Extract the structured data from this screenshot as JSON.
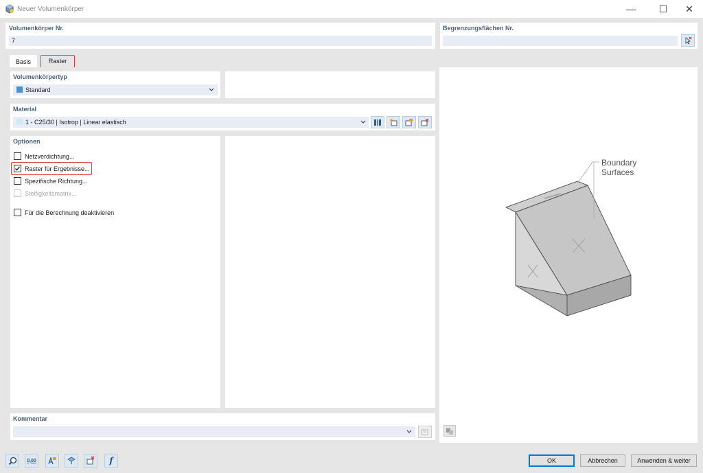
{
  "window": {
    "title": "Neuer Volumenkörper",
    "minimize_glyph": "—",
    "maximize_glyph": "☐",
    "close_glyph": "✕"
  },
  "header": {
    "solid_no_label": "Volumenkörper Nr.",
    "solid_no_value": "7",
    "boundary_label": "Begrenzungsflächen Nr.",
    "boundary_value": ""
  },
  "tabs": [
    {
      "label": "Basis",
      "active": true
    },
    {
      "label": "Raster",
      "active": false,
      "highlighted": true
    }
  ],
  "solid_type": {
    "label": "Volumenkörpertyp",
    "value": "Standard",
    "color": "#4a90d9"
  },
  "material": {
    "label": "Material",
    "value": "1 - C25/30 | Isotrop | Linear elastisch",
    "color": "#cfe9f7"
  },
  "options": {
    "label": "Optionen",
    "items": [
      {
        "label": "Netzverdichtung...",
        "checked": false,
        "disabled": false
      },
      {
        "label": "Raster für Ergebnisse...",
        "checked": true,
        "disabled": false,
        "highlighted": true
      },
      {
        "label": "Spezifische Richtung...",
        "checked": false,
        "disabled": false
      },
      {
        "label": "Steifigkeitsmatrix...",
        "checked": false,
        "disabled": true
      },
      {
        "label": "Für die Berechnung deaktivieren",
        "checked": false,
        "disabled": false
      }
    ]
  },
  "comment": {
    "label": "Kommentar",
    "value": ""
  },
  "preview": {
    "annotation_line1": "Boundary",
    "annotation_line2": "Surfaces"
  },
  "footer": {
    "icons": [
      "search-icon",
      "decimal-places-icon",
      "units-icon",
      "view-icon",
      "delete-icon",
      "function-icon"
    ],
    "decimal_label": "0,00",
    "function_label": "f",
    "ok_label": "OK",
    "cancel_label": "Abbrechen",
    "apply_label": "Anwenden & weiter"
  },
  "colors": {
    "accent": "#0078d7",
    "section_label": "#4a6079",
    "highlight": "#e04040"
  }
}
